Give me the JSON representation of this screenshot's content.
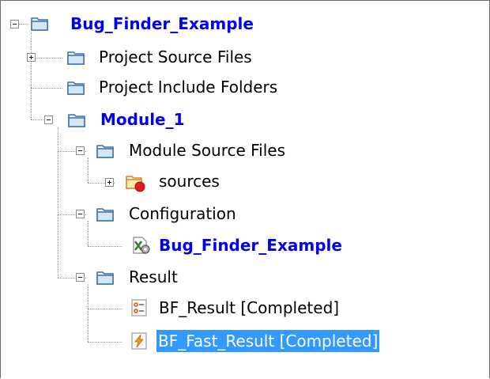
{
  "colors": {
    "link_blue": "#0000ee",
    "selection_bg": "#3399ff",
    "folder_blue": "#3f6fa9"
  },
  "tree": {
    "root": {
      "label": "Bug_Finder_Example",
      "icon": "project-folder-icon",
      "expanded": true
    },
    "project_source_files": {
      "label": "Project Source Files",
      "icon": "folder-icon",
      "expanded": false
    },
    "project_include_folders": {
      "label": "Project Include Folders",
      "icon": "folder-icon"
    },
    "module": {
      "label": "Module_1",
      "icon": "module-folder-icon",
      "expanded": true
    },
    "module_source_files": {
      "label": "Module Source Files",
      "icon": "folder-icon",
      "expanded": true
    },
    "sources": {
      "label": "sources",
      "icon": "source-folder-warning-icon",
      "expanded": false
    },
    "configuration": {
      "label": "Configuration",
      "icon": "folder-icon",
      "expanded": true
    },
    "config_item": {
      "label": "Bug_Finder_Example",
      "icon": "configuration-tool-icon"
    },
    "result": {
      "label": "Result",
      "icon": "folder-icon",
      "expanded": true
    },
    "bf_result": {
      "label": "BF_Result [Completed]",
      "icon": "result-list-icon"
    },
    "bf_fast_result": {
      "label": "BF_Fast_Result [Completed]",
      "icon": "fast-result-bolt-icon",
      "selected": true
    }
  }
}
